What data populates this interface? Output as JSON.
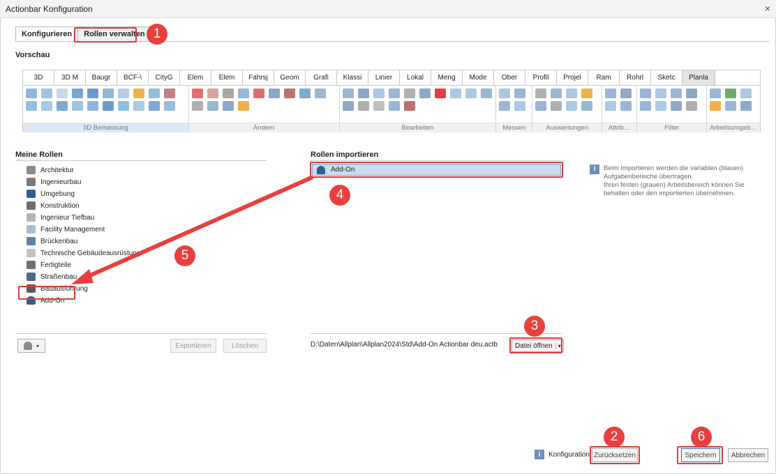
{
  "window": {
    "title": "Actionbar Konfiguration",
    "close": "×"
  },
  "tabs": {
    "configure": "Konfigurieren",
    "manage_roles": "Rollen verwalten"
  },
  "preview": {
    "label": "Vorschau",
    "tabs": [
      "3D",
      "3D M",
      "Baugr",
      "BCF-\\",
      "CityG",
      "Elem",
      "Elem",
      "Fahrsj",
      "Geom",
      "Grafi",
      "Klassi",
      "Linier",
      "Lokal",
      "Meng",
      "Mode",
      "Ober",
      "Profil",
      "Projel",
      "Ram",
      "Rohrl",
      "Sketc",
      "Planla"
    ],
    "groups": [
      "3D Bemassung",
      "Ändern",
      "Bearbeiten",
      "Messen",
      "Auswertungen",
      "Attrib…",
      "Filter",
      "Arbeitsumgeb…"
    ]
  },
  "my_roles": {
    "label": "Meine Rollen",
    "items": [
      "Architektur",
      "Ingenieurbau",
      "Umgebung",
      "Konstruktion",
      "Ingenieur Tiefbau",
      "Facility Management",
      "Brückenbau",
      "Technische Gebäudeausrüstung",
      "Fertigteile",
      "Straßenbau",
      "Bauausführung",
      "Add-On"
    ],
    "export_button": "Exportieren",
    "delete_button": "Löschen"
  },
  "import_roles": {
    "label": "Rollen importieren",
    "item": "Add-On",
    "file_path": "D:\\Daten\\Allplan\\Allplan2024\\Std\\Add-On Actionbar deu.actb",
    "open_file_button": "Datei öffnen"
  },
  "info": {
    "line1": "Beim Importieren werden die variablen (blauen) Aufgabenbereiche übertragen.",
    "line2": "Ihren festen (grauen) Arbeitsbereich können Sie behalten oder den importierten übernehmen."
  },
  "footer": {
    "config_label": "Konfiguration",
    "reset_button": "Zurücksetzen",
    "save_button": "Speichern",
    "cancel_button": "Abbrechen"
  },
  "annotations": [
    "1",
    "2",
    "3",
    "4",
    "5",
    "6"
  ],
  "colors": {
    "annotation": "#e8403e",
    "selection": "#c9dcf0",
    "accent": "#3a6fb0"
  }
}
